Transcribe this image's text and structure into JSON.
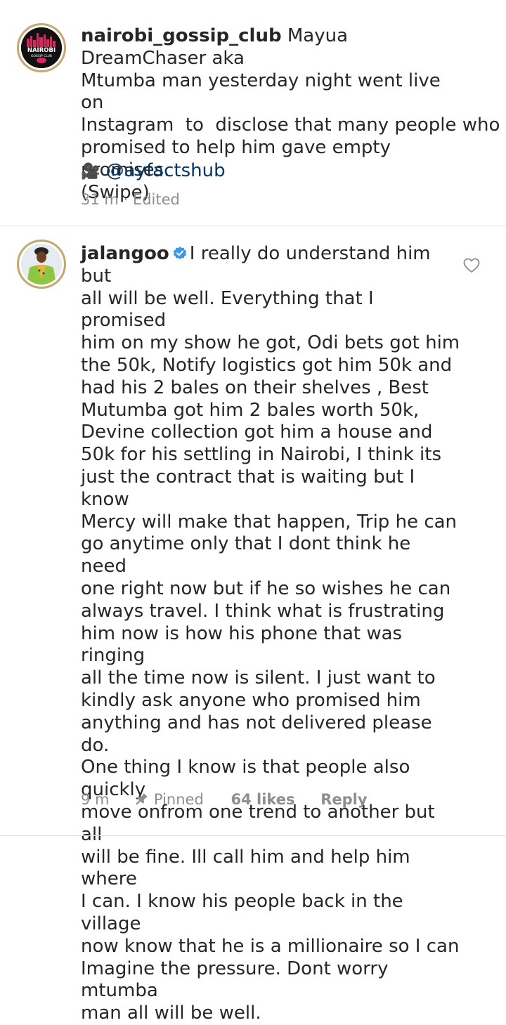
{
  "caption": {
    "username": "nairobi_gossip_club",
    "avatar_text_top": "NAIROBI",
    "avatar_text_bottom": "GOSSIP CLUB",
    "lines": [
      "Mayua DreamChaser aka",
      "Mtumba man yesterday night went live on",
      "Instagram  to  disclose that many people who",
      "promised to help him gave empty promises.",
      "(Swipe)"
    ],
    "credit_emoji": "🎥",
    "credit_handle": "@ayfactshub",
    "time": "31 m",
    "separator": "·",
    "edited": "Edited"
  },
  "comment": {
    "username": "jalangoo",
    "lines": [
      "I really do understand him but",
      "all will be well. Everything that I promised",
      "him on my show he got, Odi bets got him",
      "the 50k, Notify logistics got him 50k and",
      "had his 2 bales on their shelves , Best",
      "Mutumba got him 2 bales worth 50k,",
      "Devine collection got him a house and",
      "50k for his settling in Nairobi, I think its",
      "just the contract that is waiting but I know",
      "Mercy will make that happen, Trip he can",
      "go anytime only that I dont think he need",
      "one right now but if he so wishes he can",
      "always travel. I think what is frustrating",
      "him now is how his phone that was ringing",
      "all the time now is silent. I just want to",
      "kindly ask anyone who promised him",
      "anything and has not delivered please do.",
      "One thing I know is that people also quickly",
      "move onfrom one trend to another but all",
      "will be fine. Ill call him and help him where",
      "I can. I know his people back in the village",
      "now know that he is a millionaire so I can",
      "Imagine the pressure. Dont worry mtumba",
      "man all will be well."
    ],
    "time": "9 m",
    "pinned": "Pinned",
    "likes": "64 likes",
    "reply": "Reply"
  },
  "colors": {
    "text": "#262626",
    "meta": "#8e8e8e",
    "link": "#00376b",
    "verified": "#3897f0",
    "avatar_ring": "#c9a66b"
  }
}
